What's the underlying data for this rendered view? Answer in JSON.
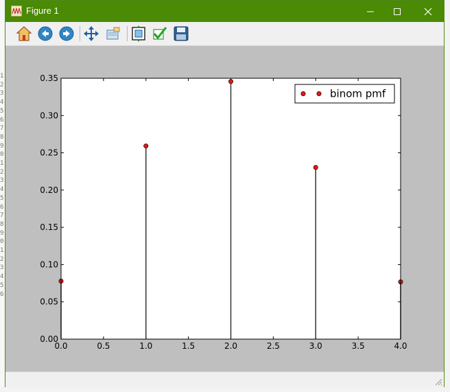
{
  "window": {
    "title": "Figure 1",
    "controls": [
      "minimize",
      "maximize",
      "close"
    ],
    "accent": "#4a8a04"
  },
  "background_gutter": {
    "line_numbers": [
      "1",
      "2",
      "3",
      "4",
      "5",
      "6",
      "7",
      "8",
      "9",
      "0",
      "1",
      "2",
      "3",
      "4",
      "5",
      "6",
      "7",
      "8",
      "9",
      "0",
      "1",
      "2",
      "3",
      "4",
      "5",
      "6"
    ]
  },
  "toolbar": {
    "buttons": [
      {
        "name": "home",
        "icon": "home-icon"
      },
      {
        "name": "back",
        "icon": "back-arrow-icon"
      },
      {
        "name": "forward",
        "icon": "forward-arrow-icon"
      },
      {
        "name": "pan",
        "icon": "move-arrows-icon"
      },
      {
        "name": "zoom",
        "icon": "zoom-rect-icon"
      },
      {
        "name": "subplots",
        "icon": "subplots-icon"
      },
      {
        "name": "edit",
        "icon": "checkmark-icon"
      },
      {
        "name": "save",
        "icon": "floppy-disk-icon"
      }
    ]
  },
  "chart_data": {
    "type": "stem",
    "x": [
      0.0,
      1.0,
      2.0,
      3.0,
      4.0
    ],
    "y": [
      0.0778,
      0.2592,
      0.3456,
      0.2304,
      0.0768
    ],
    "series": [
      {
        "name": "binom pmf",
        "marker": "circle",
        "color": "#e01818"
      }
    ],
    "stem_color": "#333333",
    "xlim": [
      0.0,
      4.0
    ],
    "ylim": [
      0.0,
      0.35
    ],
    "xticks": [
      "0.0",
      "0.5",
      "1.0",
      "1.5",
      "2.0",
      "2.5",
      "3.0",
      "3.5",
      "4.0"
    ],
    "yticks": [
      "0.00",
      "0.05",
      "0.10",
      "0.15",
      "0.20",
      "0.25",
      "0.30",
      "0.35"
    ],
    "legend": "top-right",
    "grid": false
  }
}
